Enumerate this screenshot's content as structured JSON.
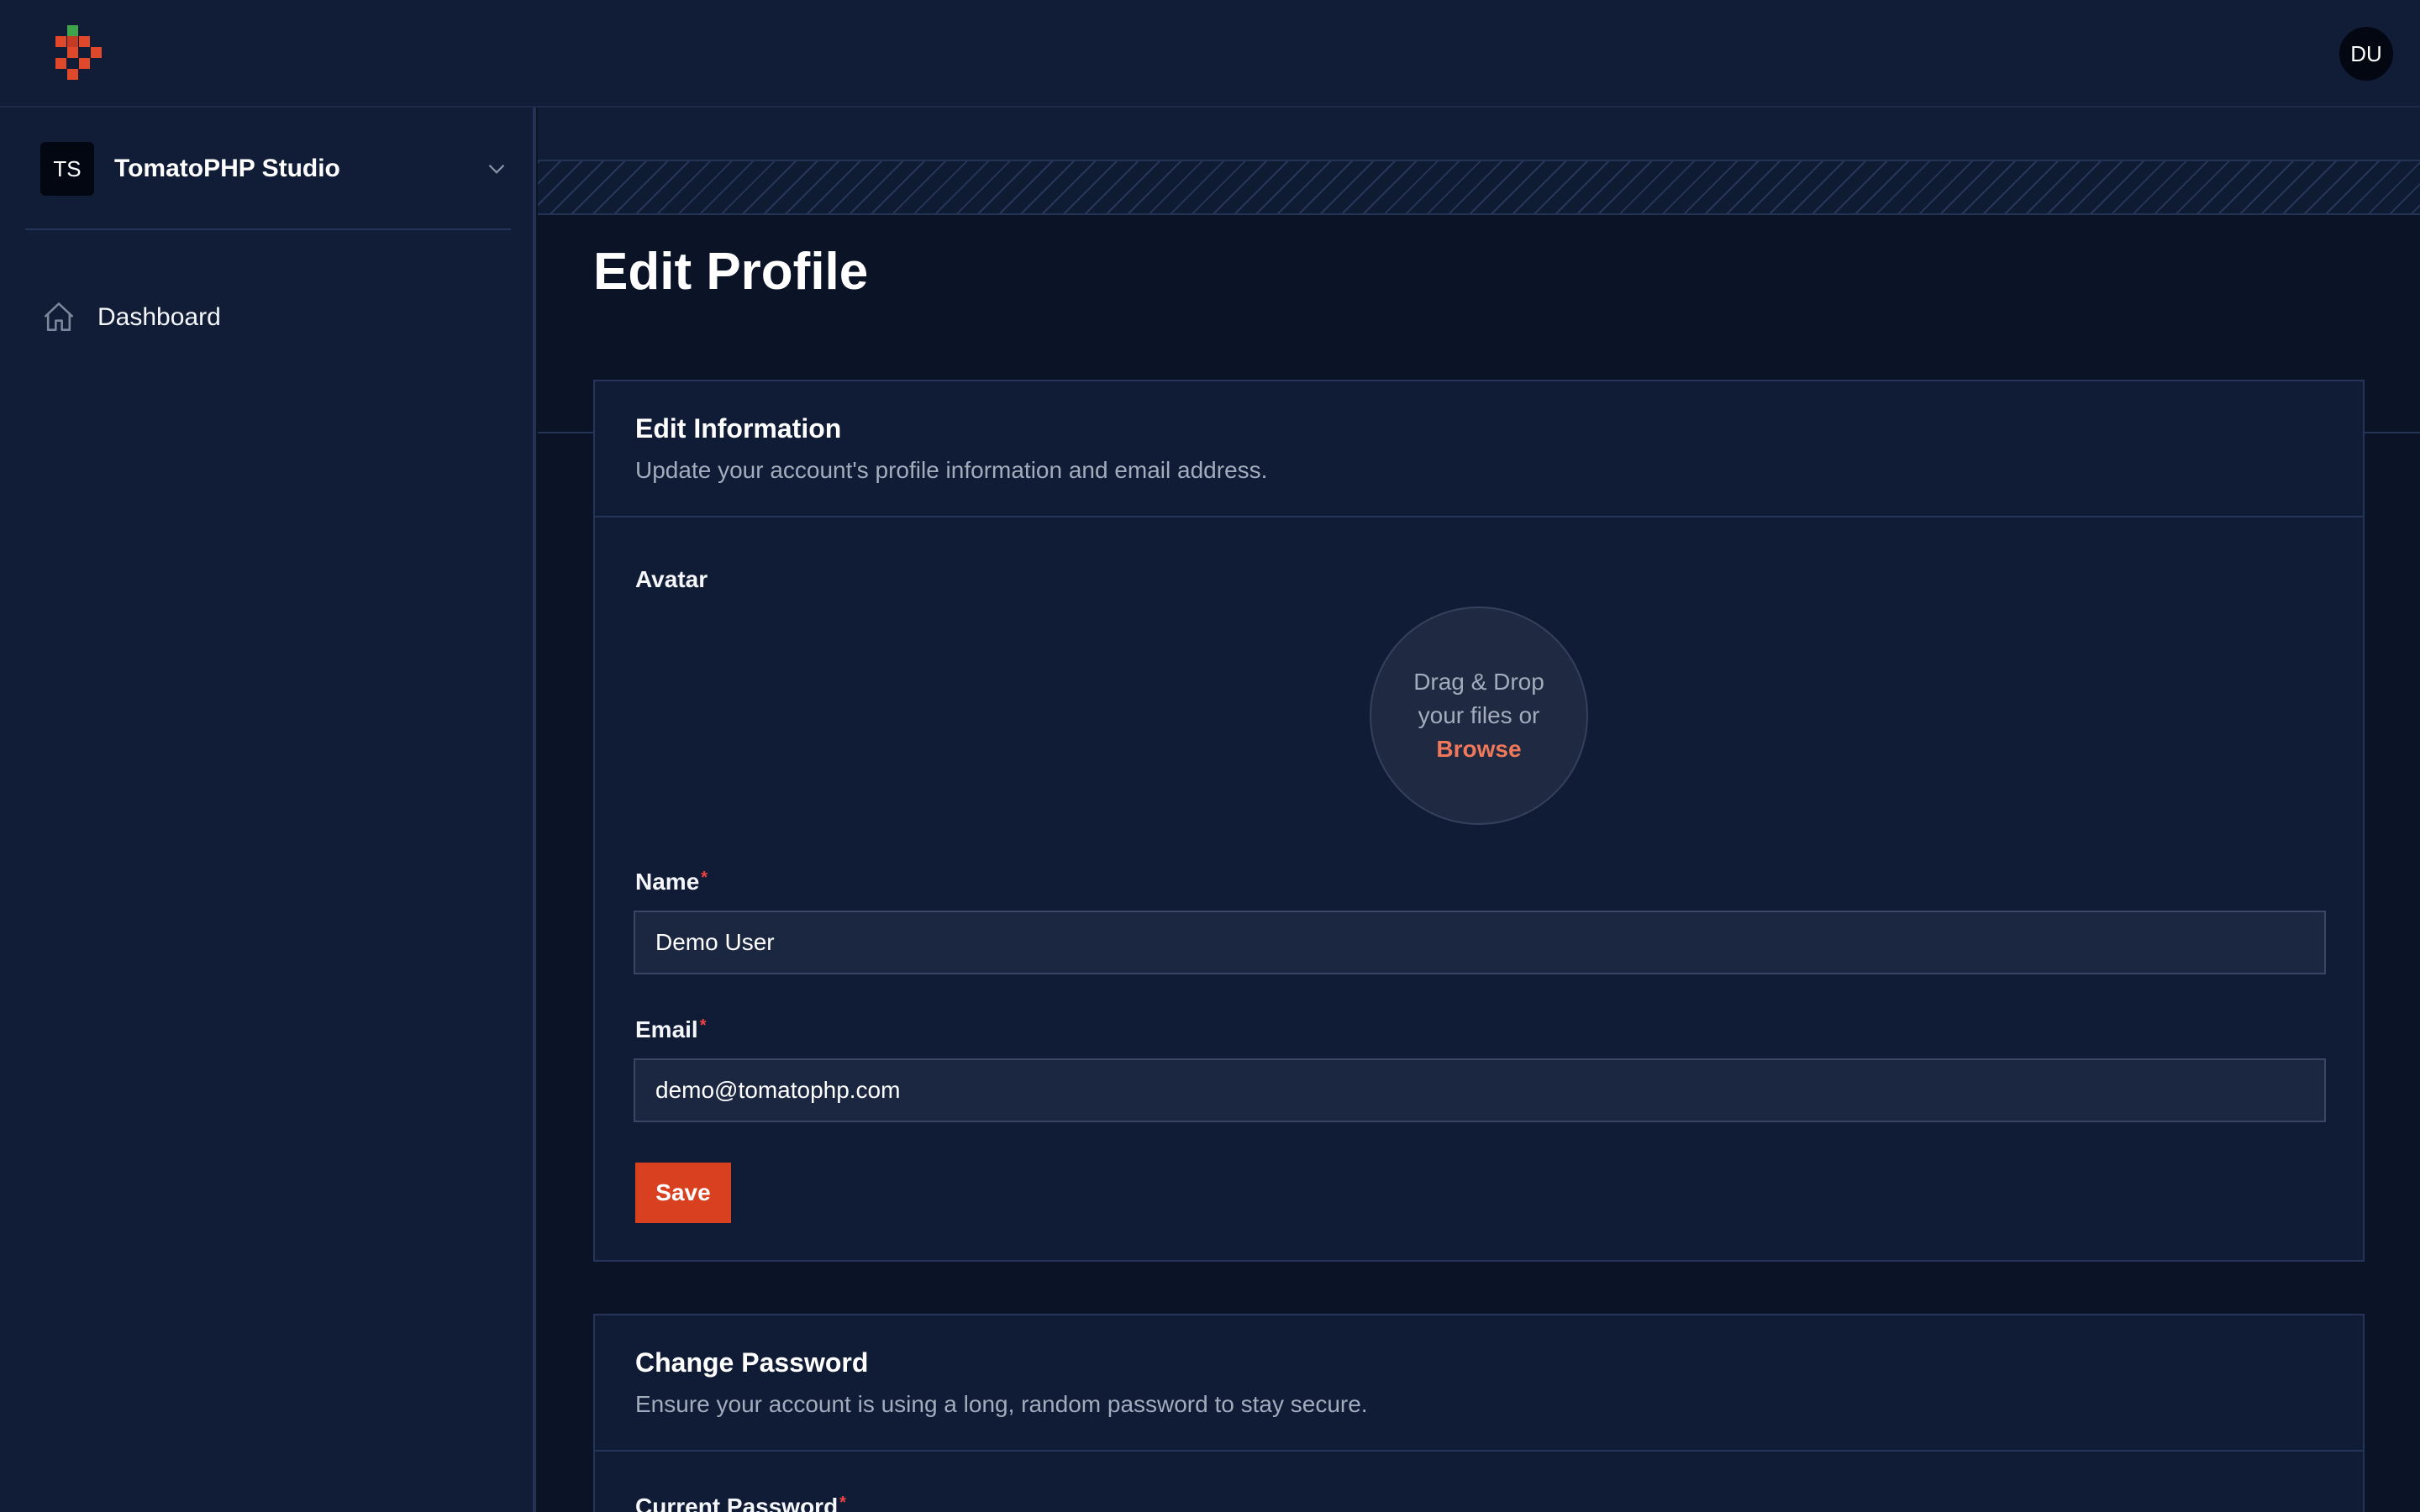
{
  "topbar": {
    "logo_icon": "tomato-pixel-logo-icon",
    "user_initials": "DU"
  },
  "sidebar": {
    "team_initials": "TS",
    "team_name": "TomatoPHP Studio",
    "team_chevron_icon": "chevron-down-icon",
    "items": [
      {
        "label": "Dashboard",
        "icon": "home-icon"
      }
    ]
  },
  "page": {
    "title": "Edit Profile"
  },
  "edit_info": {
    "title": "Edit Information",
    "description": "Update your account's profile information and email address.",
    "avatar_label": "Avatar",
    "dropzone_line1": "Drag & Drop",
    "dropzone_line2": "your files or",
    "dropzone_browse": "Browse",
    "name_label": "Name",
    "name_value": "Demo User",
    "email_label": "Email",
    "email_value": "demo@tomatophp.com",
    "required_mark": "*",
    "save_label": "Save"
  },
  "change_password": {
    "title": "Change Password",
    "description": "Ensure your account is using a long, random password to stay secure.",
    "current_password_label": "Current Password"
  },
  "colors": {
    "accent": "#d9401f",
    "link": "#f0785a",
    "background": "#0b1326",
    "panel": "#111c36"
  }
}
